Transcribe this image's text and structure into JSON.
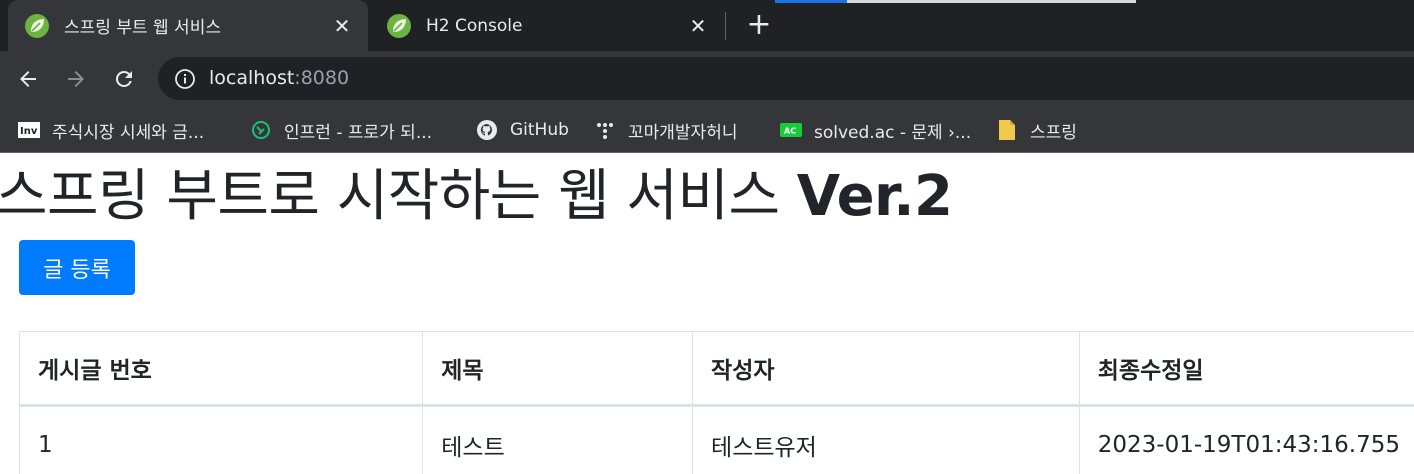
{
  "browser": {
    "tabs": [
      {
        "title": "스프링 부트 웹 서비스",
        "active": true,
        "favicon": "spring-leaf-icon"
      },
      {
        "title": "H2 Console",
        "active": false,
        "favicon": "spring-leaf-icon"
      }
    ],
    "download_progress": 0.2,
    "address": {
      "host": "localhost",
      "port": ":8080"
    },
    "bookmarks": [
      {
        "label": "주식시장 시세와 금...",
        "icon": "investing-icon"
      },
      {
        "label": "인프런 - 프로가 되...",
        "icon": "inflearn-icon"
      },
      {
        "label": "GitHub",
        "icon": "github-icon"
      },
      {
        "label": "꼬마개발자허니",
        "icon": "dots-icon"
      },
      {
        "label": "solved.ac - 문제 ›...",
        "icon": "solvedac-icon"
      },
      {
        "label": "스프링",
        "icon": "folder-icon"
      }
    ],
    "colors": {
      "tabstrip": "#202124",
      "toolbar": "#35363a",
      "accent": "#1a73e8"
    }
  },
  "page": {
    "title_main": "스프링 부트로 시작하는 웹 서비스 ",
    "title_version": "Ver.2",
    "register_button": "글 등록",
    "table": {
      "headers": [
        "게시글 번호",
        "제목",
        "작성자",
        "최종수정일"
      ],
      "rows": [
        [
          "1",
          "테스트",
          "테스트유저",
          "2023-01-19T01:43:16.755"
        ]
      ]
    },
    "colors": {
      "primary_button": "#007bff",
      "text": "#212529",
      "border": "#dee2e6"
    }
  }
}
